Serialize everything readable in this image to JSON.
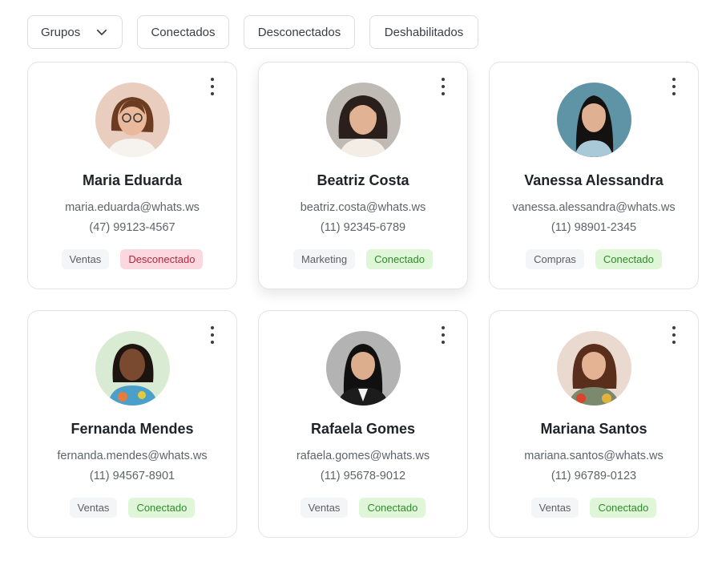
{
  "filters": {
    "groups_label": "Grupos",
    "connected_label": "Conectados",
    "disconnected_label": "Desconectados",
    "disabled_label": "Deshabilitados"
  },
  "colors": {
    "connected_bg": "#dff7d8",
    "connected_text": "#2f8a2a",
    "disconnected_bg": "#fbd8df",
    "disconnected_text": "#b0283e"
  },
  "contacts": [
    {
      "name": "Maria Eduarda",
      "email": "maria.eduarda@whats.ws",
      "phone": "(47) 99123-4567",
      "group": "Ventas",
      "status": "Desconectado",
      "status_type": "off"
    },
    {
      "name": "Beatriz Costa",
      "email": "beatriz.costa@whats.ws",
      "phone": "(11) 92345-6789",
      "group": "Marketing",
      "status": "Conectado",
      "status_type": "on"
    },
    {
      "name": "Vanessa Alessandra",
      "email": "vanessa.alessandra@whats.ws",
      "phone": "(11) 98901-2345",
      "group": "Compras",
      "status": "Conectado",
      "status_type": "on"
    },
    {
      "name": "Fernanda Mendes",
      "email": "fernanda.mendes@whats.ws",
      "phone": "(11) 94567-8901",
      "group": "Ventas",
      "status": "Conectado",
      "status_type": "on"
    },
    {
      "name": "Rafaela Gomes",
      "email": "rafaela.gomes@whats.ws",
      "phone": "(11) 95678-9012",
      "group": "Ventas",
      "status": "Conectado",
      "status_type": "on"
    },
    {
      "name": "Mariana Santos",
      "email": "mariana.santos@whats.ws",
      "phone": "(11) 96789-0123",
      "group": "Ventas",
      "status": "Conectado",
      "status_type": "on"
    }
  ]
}
